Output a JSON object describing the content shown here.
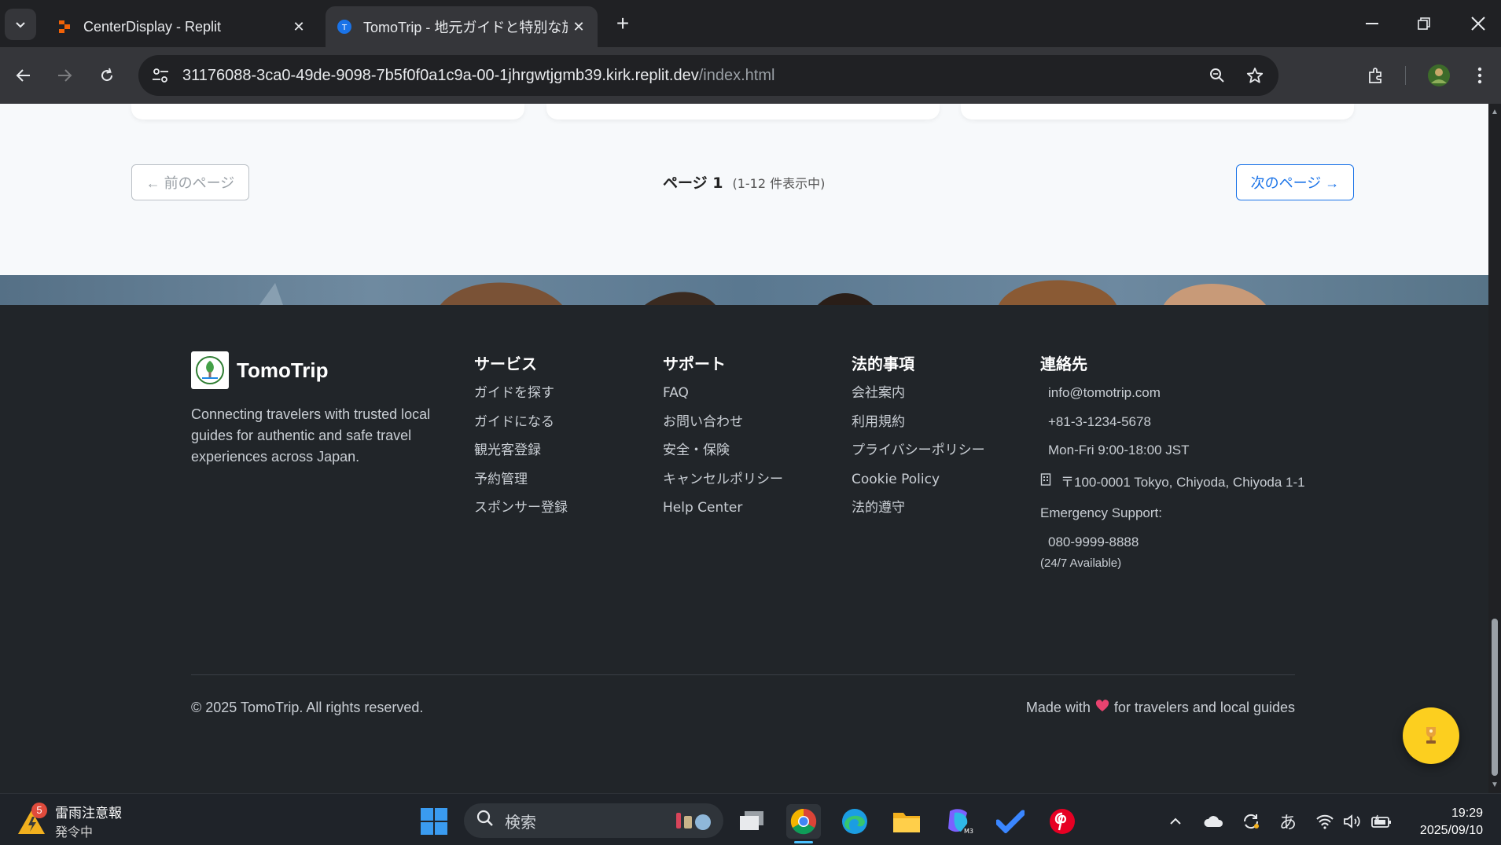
{
  "browser": {
    "tabs": [
      {
        "title": "CenterDisplay - Replit",
        "active": false
      },
      {
        "title": "TomoTrip - 地元ガイドと特別な旅",
        "active": true
      }
    ],
    "url_host": "31176088-3ca0-49de-9098-7b5f0f0a1c9a-00-1jhrgwtjgmb39.kirk.replit.dev",
    "url_path": "/index.html"
  },
  "pagination": {
    "prev_label": "← 前のページ",
    "page_label": "ページ 1",
    "count_label": "(1-12 件表示中)",
    "next_label": "次のページ →"
  },
  "footer": {
    "brand": {
      "name": "TomoTrip",
      "description": "Connecting travelers with trusted local guides for authentic and safe travel experiences across Japan."
    },
    "columns": [
      {
        "heading": "サービス",
        "links": [
          "ガイドを探す",
          "ガイドになる",
          "観光客登録",
          "予約管理",
          "スポンサー登録"
        ]
      },
      {
        "heading": "サポート",
        "links": [
          "FAQ",
          "お問い合わせ",
          "安全・保険",
          "キャンセルポリシー",
          "Help Center"
        ]
      },
      {
        "heading": "法的事項",
        "links": [
          "会社案内",
          "利用規約",
          "プライバシーポリシー",
          "Cookie Policy",
          "法的遵守"
        ]
      }
    ],
    "contact": {
      "heading": "連絡先",
      "email": "info@tomotrip.com",
      "phone": "+81-3-1234-5678",
      "hours": "Mon-Fri 9:00-18:00 JST",
      "address": "〒100-0001 Tokyo, Chiyoda, Chiyoda 1-1",
      "emergency_label": "Emergency Support:",
      "emergency_phone": "080-9999-8888",
      "emergency_availability": "(24/7 Available)"
    },
    "copyright": "© 2025 TomoTrip. All rights reserved.",
    "made_with_prefix": "Made with",
    "made_with_suffix": "for travelers and local guides"
  },
  "taskbar": {
    "weather_badge": "5",
    "weather_title": "雷雨注意報",
    "weather_sub": "発令中",
    "search_placeholder": "検索",
    "ime_label": "あ",
    "time": "19:29",
    "date": "2025/09/10"
  },
  "colors": {
    "accent": "#1a73e8",
    "footer_bg": "#212529",
    "fab": "#fccf1f"
  }
}
